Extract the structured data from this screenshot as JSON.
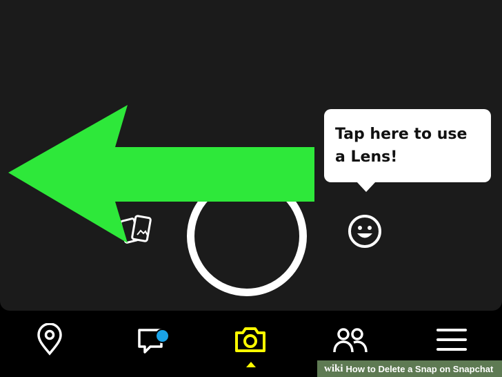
{
  "tooltip": {
    "text": "Tap here to use a Lens!"
  },
  "icons": {
    "memories": "memories-icon",
    "lens": "smiley-icon",
    "capture": "capture-ring"
  },
  "nav": {
    "items": [
      {
        "name": "map",
        "icon": "map-pin-icon"
      },
      {
        "name": "chat",
        "icon": "chat-icon",
        "has_notification": true
      },
      {
        "name": "camera",
        "icon": "camera-icon",
        "active": true
      },
      {
        "name": "friends",
        "icon": "friends-icon"
      },
      {
        "name": "menu",
        "icon": "hamburger-icon"
      }
    ]
  },
  "colors": {
    "arrow": "#2ee83a",
    "active": "#fffc00",
    "notification": "#1aa3e8",
    "watermark_bg": "#5e7a53"
  },
  "watermark": {
    "brand": "wiki",
    "text": "How to Delete a Snap on Snapchat"
  }
}
